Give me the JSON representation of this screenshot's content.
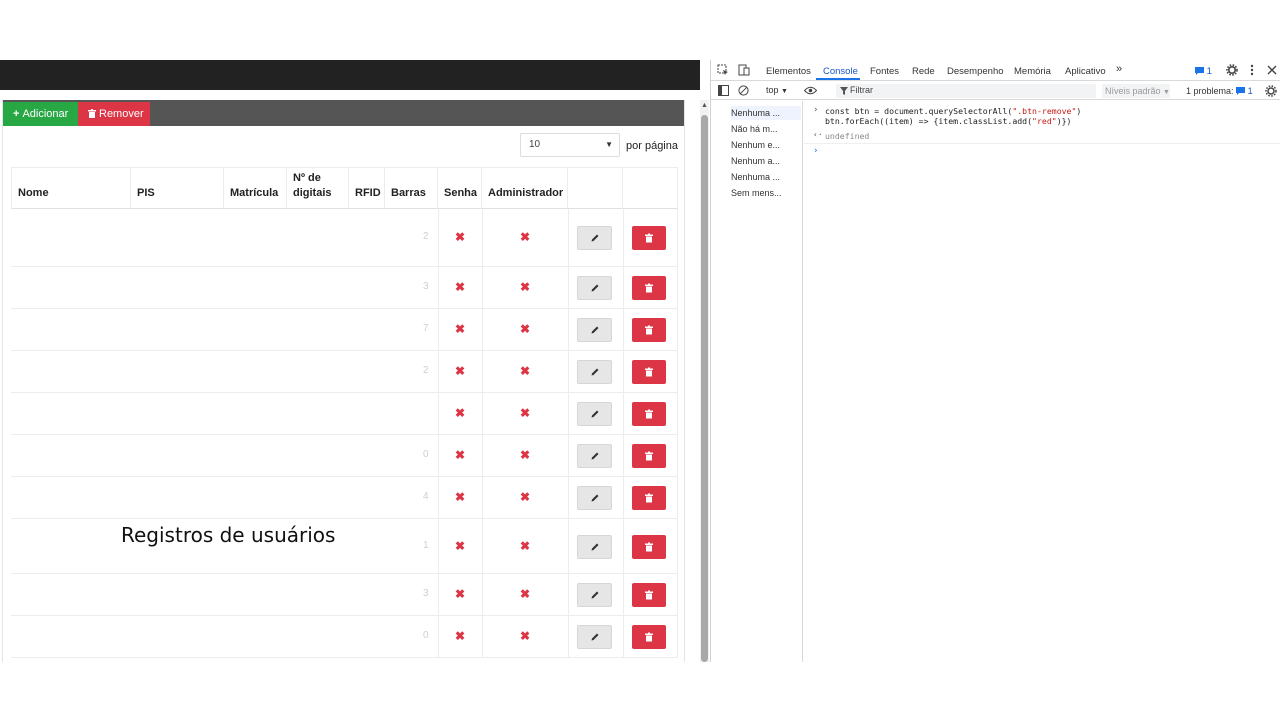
{
  "page": {
    "toolbar": {
      "add_label": "Adicionar",
      "add_glyph": "+",
      "remove_label": "Remover"
    },
    "per_page": {
      "value": "10",
      "label": "por página"
    },
    "table": {
      "headers": [
        "Nome",
        "PIS",
        "Matrícula",
        "Nº de digitais",
        "RFID",
        "Barras",
        "Senha",
        "Administrador",
        "",
        ""
      ],
      "rows": [
        {
          "barras": "2",
          "senha": "✖",
          "admin": "✖"
        },
        {
          "barras": "3",
          "senha": "✖",
          "admin": "✖"
        },
        {
          "barras": "7",
          "senha": "✖",
          "admin": "✖"
        },
        {
          "barras": "2",
          "senha": "✖",
          "admin": "✖"
        },
        {
          "barras": "",
          "senha": "✖",
          "admin": "✖"
        },
        {
          "barras": "0",
          "senha": "✖",
          "admin": "✖"
        },
        {
          "barras": "4",
          "senha": "✖",
          "admin": "✖"
        },
        {
          "barras": "1",
          "senha": "✖",
          "admin": "✖"
        },
        {
          "barras": "3",
          "senha": "✖",
          "admin": "✖"
        },
        {
          "barras": "0",
          "senha": "✖",
          "admin": "✖"
        }
      ]
    },
    "overlay_caption": "Registros de usuários"
  },
  "devtools": {
    "tabs": [
      "Elementos",
      "Console",
      "Fontes",
      "Rede",
      "Desempenho",
      "Memória",
      "Aplicativo"
    ],
    "active_tab": "Console",
    "message_badge": "1",
    "context": "top",
    "filter_placeholder": "Filtrar",
    "levels": "Níveis padrão",
    "problems_label": "1 problema:",
    "problems_count": "1",
    "sidebar": [
      {
        "icon": "list-icon",
        "label": "Nenhuma ..."
      },
      {
        "icon": "user-icon",
        "label": "Não há m..."
      },
      {
        "icon": "error-icon",
        "label": "Nenhum e..."
      },
      {
        "icon": "warning-icon",
        "label": "Nenhum a..."
      },
      {
        "icon": "info-icon",
        "label": "Nenhuma ..."
      },
      {
        "icon": "bug-icon",
        "label": "Sem mens..."
      }
    ],
    "console": {
      "line1_a": "const btn = document.querySelectorAll(",
      "line1_str": "\".btn-remove\"",
      "line1_b": ")",
      "line2_a": "btn.forEach((item) => {item.classList.add(",
      "line2_str": "\"red\"",
      "line2_b": ")})",
      "result": "undefined"
    }
  },
  "colors": {
    "add": "#28a745",
    "remove": "#dc3545",
    "header": "#555555",
    "topbar": "#222222",
    "devtools_accent": "#1a73e8"
  }
}
